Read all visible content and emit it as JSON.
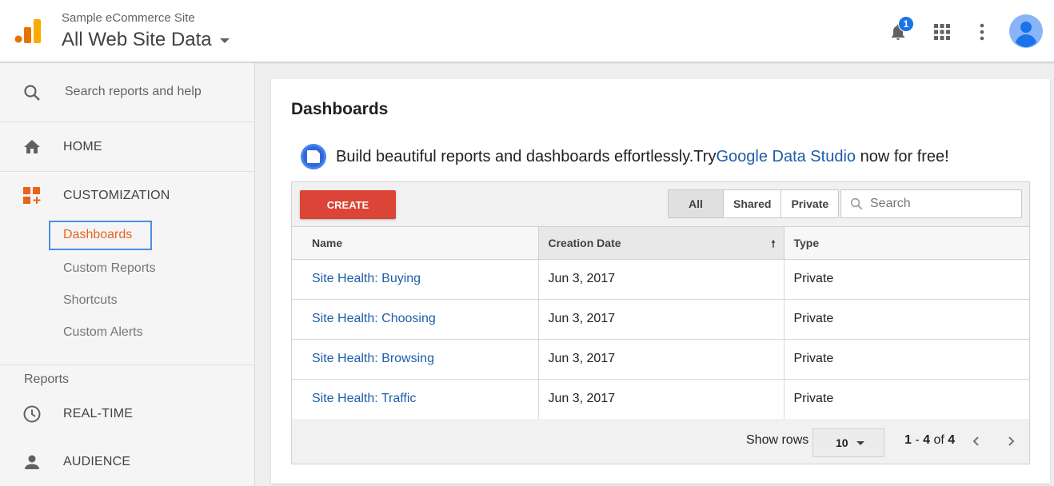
{
  "header": {
    "property_small": "Sample eCommerce Site",
    "property_big": "All Web Site Data",
    "notification_count": "1",
    "icons": [
      "analytics-logo-icon",
      "bell-icon",
      "apps-grid-icon",
      "more-vert-icon",
      "account-avatar-icon"
    ]
  },
  "sidebar": {
    "search_placeholder": "Search reports and help",
    "home_label": "HOME",
    "customization_label": "CUSTOMIZATION",
    "customization_items": [
      "Dashboards",
      "Custom Reports",
      "Shortcuts",
      "Custom Alerts"
    ],
    "reports_heading": "Reports",
    "realtime_label": "REAL-TIME",
    "audience_label": "AUDIENCE"
  },
  "main": {
    "title": "Dashboards",
    "promo": {
      "prefix": "Build beautiful reports and dashboards effortlessly.Try ",
      "link": "Google Data Studio",
      "suffix": " now for free!"
    },
    "create_label": "CREATE",
    "filters": [
      "All",
      "Shared",
      "Private"
    ],
    "active_filter": "All",
    "search_placeholder": "Search",
    "columns": [
      "Name",
      "Creation Date",
      "Type"
    ],
    "sorted_column": "Creation Date",
    "rows": [
      {
        "name": "Site Health: Buying",
        "date": "Jun 3, 2017",
        "type": "Private"
      },
      {
        "name": "Site Health: Choosing",
        "date": "Jun 3, 2017",
        "type": "Private"
      },
      {
        "name": "Site Health: Browsing",
        "date": "Jun 3, 2017",
        "type": "Private"
      },
      {
        "name": "Site Health: Traffic",
        "date": "Jun 3, 2017",
        "type": "Private"
      }
    ],
    "footer": {
      "show_rows_label": "Show rows",
      "rows_per_page": "10",
      "range_start": "1",
      "range_sep": " - ",
      "range_end": "4",
      "of_label": " of ",
      "total": "4"
    }
  },
  "colors": {
    "accent_orange": "#e8641b",
    "create_red": "#db4437",
    "link_blue": "#1e5ea8",
    "badge_blue": "#1a73e8",
    "focus_blue": "#4a90e2"
  }
}
